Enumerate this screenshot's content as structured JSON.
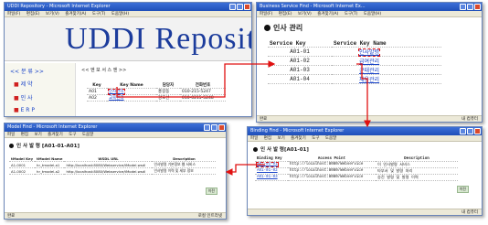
{
  "win1": {
    "title": "UDDI Repository - Microsoft Internet Explorer",
    "menu": [
      "파일(F)",
      "편집(E)",
      "보기(V)",
      "즐겨찾기(A)",
      "도구(T)",
      "도움말(H)"
    ],
    "banner": "UDDI Reposito",
    "nav_title": "<< 분 류 >>",
    "nav_items": [
      "제 약",
      "인 사",
      "E R P",
      "재 제"
    ],
    "content_title": "<< 엔 보 서 스 엔 >>",
    "headers": [
      "Key",
      "Key Name",
      "담당자",
      "전화번호"
    ],
    "rows": [
      [
        "A01",
        "인사관리",
        "홍길동",
        "010-215-5247"
      ],
      [
        "A02",
        "교육관리",
        "강호선",
        "010-0215-5248"
      ]
    ]
  },
  "win2": {
    "title": "Business Service Find - Microsoft Internet Ex...",
    "menu": [
      "파일(F)",
      "편집(E)",
      "보기(V)",
      "즐겨찾기(A)",
      "도구(T)",
      "도움말(H)"
    ],
    "heading": "인사 관리",
    "headers": [
      "Service Key",
      "Service Key Name"
    ],
    "rows": [
      [
        "A01-01",
        "인사발령"
      ],
      [
        "A01-02",
        "급여관리"
      ],
      [
        "A01-03",
        "근태관리"
      ],
      [
        "A01-04",
        "채용관리"
      ]
    ],
    "status_left": "완료",
    "status_right": "내 컴퓨터"
  },
  "win3": {
    "title": "Binding Find - Microsoft Internet Explorer",
    "menu": [
      "파일",
      "편집",
      "보기",
      "즐겨찾기",
      "도구",
      "도움말"
    ],
    "heading": "인 사 발 령[A01-01]",
    "headers": [
      "Binding Key",
      "Access Point",
      "Description"
    ],
    "rows": [
      [
        "A01-01-01",
        "http://localhost:8080/Webservice",
        "이 인사발령 서비스"
      ],
      [
        "A01-01-02",
        "http://localhost:8080/Webservice",
        "타부서 및 발령 처리"
      ],
      [
        "A01-01-03",
        "http://localhost:8080/Webservice",
        "승진 발령 및 발령 이력"
      ]
    ],
    "back_label": "이전",
    "status_right": "내 컴퓨터"
  },
  "win4": {
    "title": "Model Find - Microsoft Internet Explorer",
    "menu": [
      "파일",
      "편집",
      "보기",
      "즐겨찾기",
      "도구",
      "도움말"
    ],
    "heading": "인 사 발 령 [A01-01-A01]",
    "headers": [
      "tModel Key",
      "tModel Name",
      "WSDL URL",
      "Description"
    ],
    "rows": [
      [
        "A1-0001",
        "hr_tmodel-a1",
        "http://localhost:8080/Webservice/tModel.wsdl",
        "인사발령 기본정보 웹 서비스"
      ],
      [
        "A1-0002",
        "hr_tmodel-a2",
        "http://localhost:8080/Webservice/tModel.wsdl",
        "인사발령 이력 및 세부 정보"
      ]
    ],
    "back_label": "이전",
    "status_left": "완료",
    "status_right": "로컬 인트라넷"
  }
}
